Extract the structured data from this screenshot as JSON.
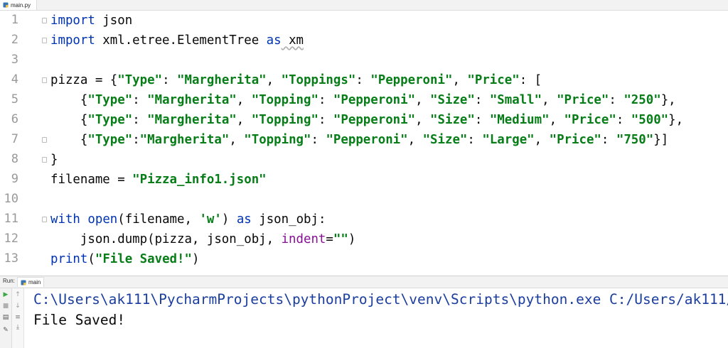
{
  "editor_tab": {
    "filename": "main.py"
  },
  "gutter": {
    "line_numbers": [
      "1",
      "2",
      "3",
      "4",
      "5",
      "6",
      "7",
      "8",
      "9",
      "10",
      "11",
      "12",
      "13"
    ]
  },
  "code": {
    "l1_kw": "import",
    "l1_rest": " json",
    "l2_kw": "import",
    "l2_mod": " xml.etree.ElementTree ",
    "l2_as": "as",
    "l2_alias": " xm",
    "l4_a": "pizza = {",
    "l4_k1": "\"Type\"",
    "l4_b": ": ",
    "l4_v1": "\"Margherita\"",
    "l4_c": ", ",
    "l4_k2": "\"Toppings\"",
    "l4_d": ": ",
    "l4_v2": "\"Pepperoni\"",
    "l4_e": ", ",
    "l4_k3": "\"Price\"",
    "l4_f": ": [",
    "l5_a": "    {",
    "l5_k1": "\"Type\"",
    "l5_b": ": ",
    "l5_v1": "\"Margherita\"",
    "l5_c": ", ",
    "l5_k2": "\"Topping\"",
    "l5_d": ": ",
    "l5_v2": "\"Pepperoni\"",
    "l5_e": ", ",
    "l5_k3": "\"Size\"",
    "l5_f": ": ",
    "l5_v3": "\"Small\"",
    "l5_g": ", ",
    "l5_k4": "\"Price\"",
    "l5_h": ": ",
    "l5_v4": "\"250\"",
    "l5_i": "},",
    "l6_a": "    {",
    "l6_k1": "\"Type\"",
    "l6_b": ": ",
    "l6_v1": "\"Margherita\"",
    "l6_c": ", ",
    "l6_k2": "\"Topping\"",
    "l6_d": ": ",
    "l6_v2": "\"Pepperoni\"",
    "l6_e": ", ",
    "l6_k3": "\"Size\"",
    "l6_f": ": ",
    "l6_v3": "\"Medium\"",
    "l6_g": ", ",
    "l6_k4": "\"Price\"",
    "l6_h": ": ",
    "l6_v4": "\"500\"",
    "l6_i": "},",
    "l7_a": "    {",
    "l7_k1": "\"Type\"",
    "l7_b": ":",
    "l7_v1": "\"Margherita\"",
    "l7_c": ", ",
    "l7_k2": "\"Topping\"",
    "l7_d": ": ",
    "l7_v2": "\"Pepperoni\"",
    "l7_e": ", ",
    "l7_k3": "\"Size\"",
    "l7_f": ": ",
    "l7_v3": "\"Large\"",
    "l7_g": ", ",
    "l7_k4": "\"Price\"",
    "l7_h": ": ",
    "l7_v4": "\"750\"",
    "l7_i": "}]",
    "l8": "}",
    "l9_a": "filename = ",
    "l9_v": "\"Pizza_info1.json\"",
    "l11_kw": "with",
    "l11_sp": " ",
    "l11_open": "open",
    "l11_a": "(filename, ",
    "l11_mode": "'w'",
    "l11_b": ") ",
    "l11_as": "as",
    "l11_c": " json_obj:",
    "l12_a": "    json.dump(pizza, json_obj, ",
    "l12_kwarg": "indent",
    "l12_b": "=",
    "l12_v": "\"\"",
    "l12_c": ")",
    "l13_fn": "print",
    "l13_a": "(",
    "l13_v": "\"File Saved!\"",
    "l13_b": ")"
  },
  "run_panel": {
    "label": "Run:",
    "tab_label": "main",
    "command": "C:\\Users\\ak111\\PycharmProjects\\pythonProject\\venv\\Scripts\\python.exe C:/Users/ak111/",
    "output": "File Saved!"
  },
  "colors": {
    "keyword": "#0033b3",
    "string": "#067d17",
    "kwarg": "#871094",
    "console_cmd": "#1a3d9e"
  }
}
